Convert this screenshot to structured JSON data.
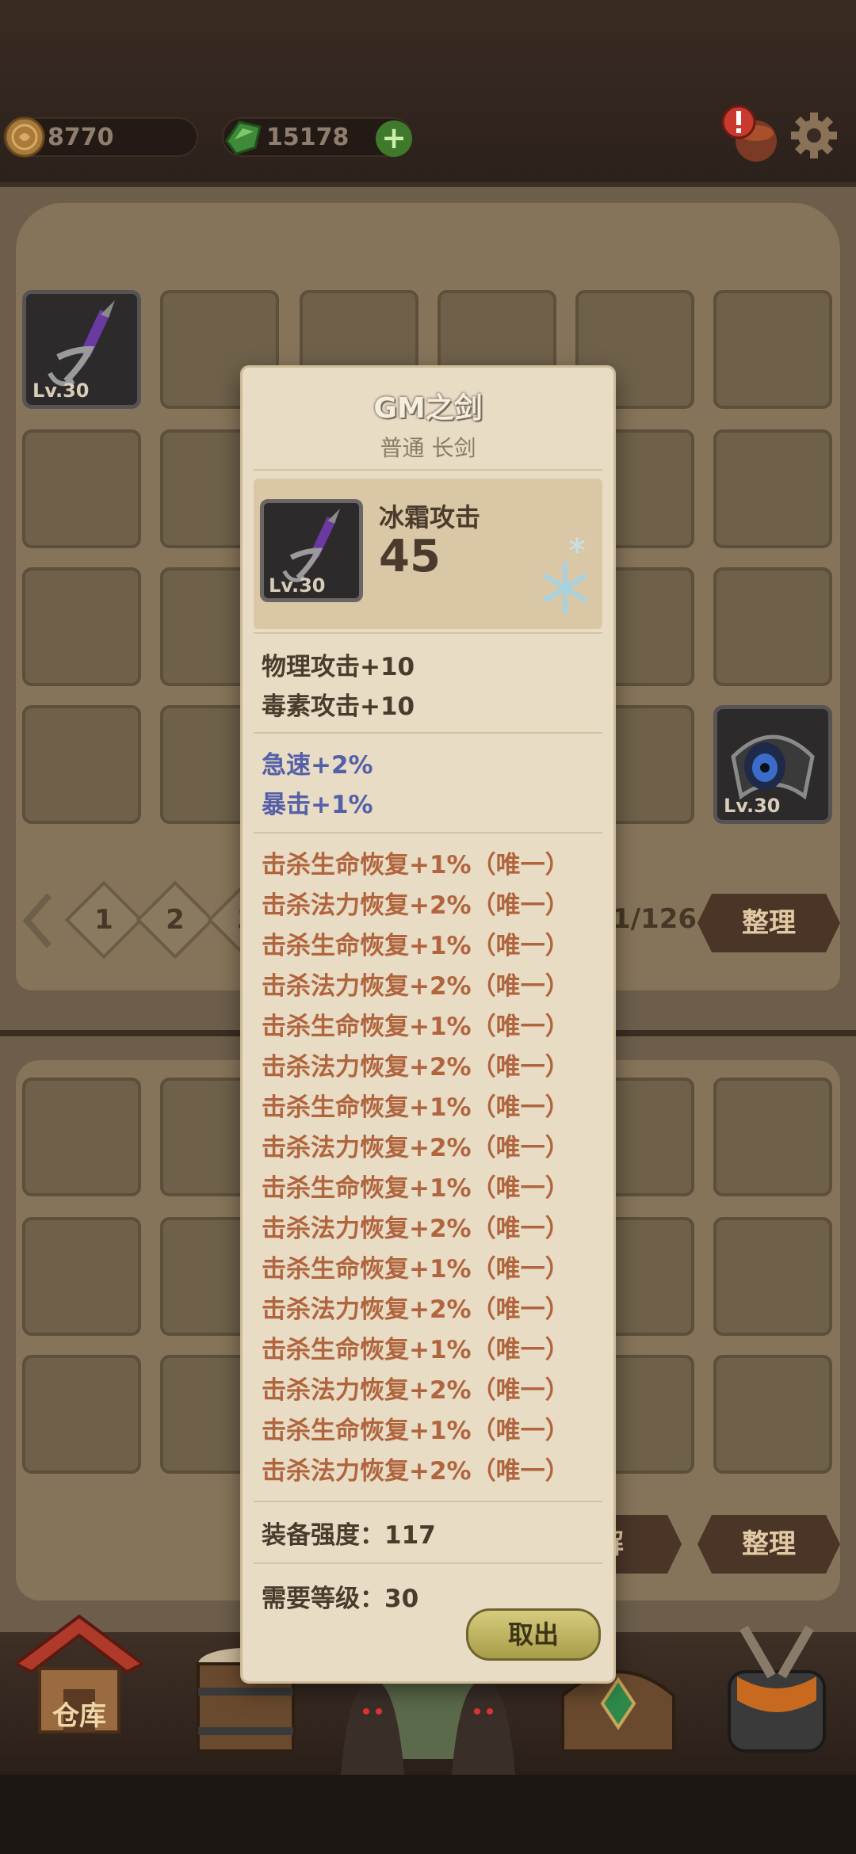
{
  "topbar": {
    "gold": "8770",
    "gems": "15178",
    "add_label": "+"
  },
  "storage": {
    "items": [
      {
        "name": "sword",
        "level": "Lv.30"
      },
      {
        "name": "eye-charm",
        "level": "Lv.30"
      }
    ],
    "pages": [
      "1",
      "2",
      "3"
    ],
    "page_count": "1/126",
    "sort_label": "整理",
    "decompose_label": "解",
    "sort_label_2": "整理"
  },
  "tooltip": {
    "title": "GM之剑",
    "subtitle": "普通 长剑",
    "icon_level": "Lv.30",
    "main_stat_label": "冰霜攻击",
    "main_stat_value": "45",
    "base_stats": [
      "物理攻击+10",
      "毒素攻击+10"
    ],
    "extra_stats": [
      "急速+2%",
      "暴击+1%"
    ],
    "unique_stats": [
      "击杀生命恢复+1%（唯一）",
      "击杀法力恢复+2%（唯一）",
      "击杀生命恢复+1%（唯一）",
      "击杀法力恢复+2%（唯一）",
      "击杀生命恢复+1%（唯一）",
      "击杀法力恢复+2%（唯一）",
      "击杀生命恢复+1%（唯一）",
      "击杀法力恢复+2%（唯一）",
      "击杀生命恢复+1%（唯一）",
      "击杀法力恢复+2%（唯一）",
      "击杀生命恢复+1%（唯一）",
      "击杀法力恢复+2%（唯一）",
      "击杀生命恢复+1%（唯一）",
      "击杀法力恢复+2%（唯一）",
      "击杀生命恢复+1%（唯一）",
      "击杀法力恢复+2%（唯一）"
    ],
    "power": "装备强度：117",
    "required_level": "需要等级：30",
    "withdraw_label": "取出"
  },
  "nav": {
    "warehouse_label": "仓库"
  },
  "colors": {
    "unique_text": "#b0653e",
    "extra_text": "#5560a8",
    "parchment": "#e8dcc4"
  }
}
